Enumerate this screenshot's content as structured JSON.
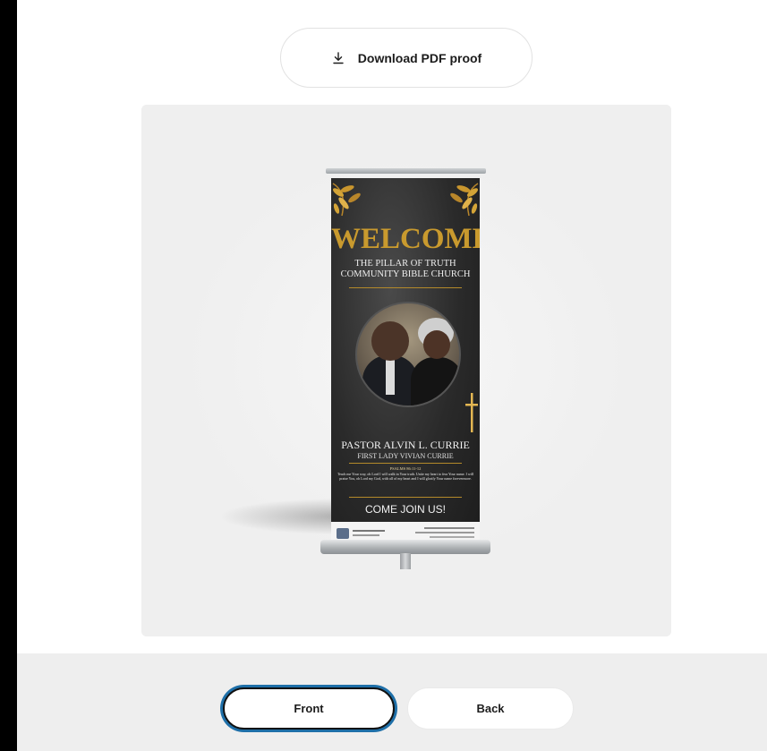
{
  "toolbar": {
    "download_label": "Download PDF proof",
    "download_icon": "download-icon"
  },
  "preview": {
    "banner": {
      "heading": "WELCOME",
      "org_line1": "THE PILLAR OF TRUTH",
      "org_line2": "COMMUNITY BIBLE CHURCH",
      "pastor": "PASTOR ALVIN L. CURRIE",
      "first_lady": "FIRST LADY VIVIAN CURRIE",
      "psalm_ref": "PSALMS 86:11-12",
      "psalm_text": "Teach me Your way, oh Lord I will walk in Your truth. Unite my heart to fear Your name. I will praise You, oh Lord my God, with all of my heart and I will glorify Your name forevermore.",
      "cta": "COME JOIN US!",
      "accent_color": "#c99a2e"
    }
  },
  "sides": {
    "front_label": "Front",
    "back_label": "Back",
    "selected": "Front"
  }
}
